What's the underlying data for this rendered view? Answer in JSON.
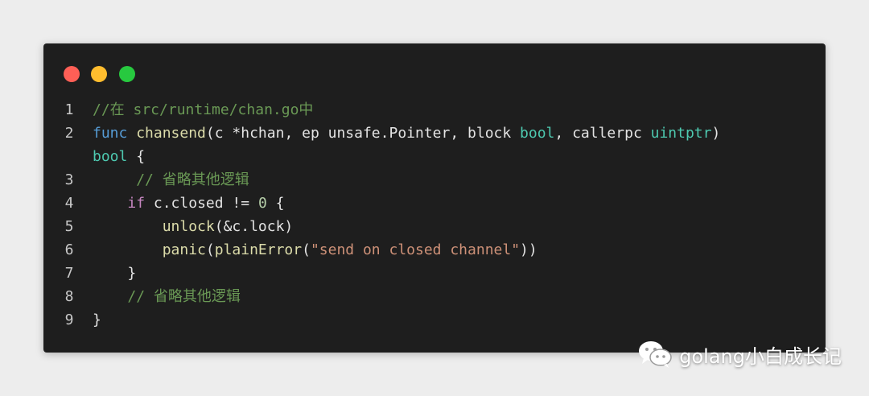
{
  "window_controls": {
    "close_color": "#ff5f56",
    "minimize_color": "#ffbd2e",
    "zoom_color": "#27c93f"
  },
  "code_lines": [
    {
      "number": "1",
      "indent": "",
      "tokens": [
        {
          "text": "//在 src/runtime/chan.go中",
          "kind": "comment"
        }
      ]
    },
    {
      "number": "2",
      "indent": "",
      "tokens": [
        {
          "text": "func",
          "kind": "keyword"
        },
        {
          "text": " ",
          "kind": "plain"
        },
        {
          "text": "chansend",
          "kind": "func"
        },
        {
          "text": "(c *hchan, ep unsafe.Pointer, block ",
          "kind": "plain"
        },
        {
          "text": "bool",
          "kind": "type"
        },
        {
          "text": ", callerpc ",
          "kind": "plain"
        },
        {
          "text": "uintptr",
          "kind": "type"
        },
        {
          "text": ")",
          "kind": "plain"
        }
      ]
    },
    {
      "number": "",
      "indent": "",
      "tokens": [
        {
          "text": "bool",
          "kind": "type"
        },
        {
          "text": " {",
          "kind": "plain"
        }
      ]
    },
    {
      "number": "3",
      "indent": "     ",
      "tokens": [
        {
          "text": "// 省略其他逻辑",
          "kind": "comment"
        }
      ]
    },
    {
      "number": "4",
      "indent": "    ",
      "tokens": [
        {
          "text": "if",
          "kind": "control"
        },
        {
          "text": " c.closed != ",
          "kind": "plain"
        },
        {
          "text": "0",
          "kind": "number"
        },
        {
          "text": " {",
          "kind": "plain"
        }
      ]
    },
    {
      "number": "5",
      "indent": "        ",
      "tokens": [
        {
          "text": "unlock",
          "kind": "func"
        },
        {
          "text": "(&c.lock)",
          "kind": "plain"
        }
      ]
    },
    {
      "number": "6",
      "indent": "        ",
      "tokens": [
        {
          "text": "panic",
          "kind": "func"
        },
        {
          "text": "(",
          "kind": "plain"
        },
        {
          "text": "plainError",
          "kind": "func"
        },
        {
          "text": "(",
          "kind": "plain"
        },
        {
          "text": "\"send on closed channel\"",
          "kind": "string"
        },
        {
          "text": "))",
          "kind": "plain"
        }
      ]
    },
    {
      "number": "7",
      "indent": "    ",
      "tokens": [
        {
          "text": "}",
          "kind": "plain"
        }
      ]
    },
    {
      "number": "8",
      "indent": "    ",
      "tokens": [
        {
          "text": "// 省略其他逻辑",
          "kind": "comment"
        }
      ]
    },
    {
      "number": "9",
      "indent": "",
      "tokens": [
        {
          "text": "}",
          "kind": "plain"
        }
      ]
    }
  ],
  "watermark": {
    "icon": "wechat-icon",
    "text": "golang小白成长记"
  }
}
